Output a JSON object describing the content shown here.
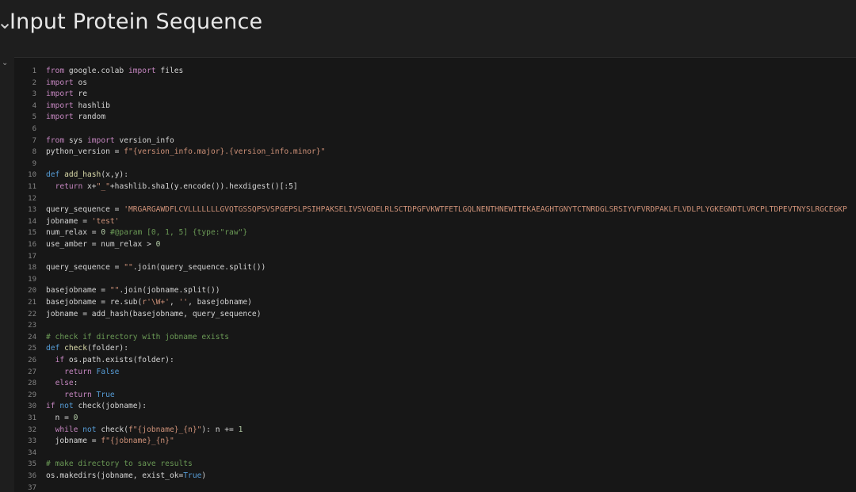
{
  "header": {
    "chevron": "⌄",
    "title": "Input Protein Sequence"
  },
  "cell": {
    "collapse_icon": "⌄"
  },
  "code": {
    "lines": [
      {
        "n": "1",
        "segs": [
          [
            "kw",
            "from "
          ],
          [
            "plain",
            "google.colab "
          ],
          [
            "kw",
            "import "
          ],
          [
            "plain",
            "files"
          ]
        ]
      },
      {
        "n": "2",
        "segs": [
          [
            "kw",
            "import "
          ],
          [
            "plain",
            "os"
          ]
        ]
      },
      {
        "n": "3",
        "segs": [
          [
            "kw",
            "import "
          ],
          [
            "plain",
            "re"
          ]
        ]
      },
      {
        "n": "4",
        "segs": [
          [
            "kw",
            "import "
          ],
          [
            "plain",
            "hashlib"
          ]
        ]
      },
      {
        "n": "5",
        "segs": [
          [
            "kw",
            "import "
          ],
          [
            "plain",
            "random"
          ]
        ]
      },
      {
        "n": "6",
        "segs": []
      },
      {
        "n": "7",
        "segs": [
          [
            "kw",
            "from "
          ],
          [
            "plain",
            "sys "
          ],
          [
            "kw",
            "import "
          ],
          [
            "plain",
            "version_info"
          ]
        ]
      },
      {
        "n": "8",
        "segs": [
          [
            "plain",
            "python_version = "
          ],
          [
            "str",
            "f\"{version_info.major}.{version_info.minor}\""
          ]
        ]
      },
      {
        "n": "9",
        "segs": []
      },
      {
        "n": "10",
        "segs": [
          [
            "kw2",
            "def "
          ],
          [
            "fn",
            "add_hash"
          ],
          [
            "plain",
            "(x,y):"
          ]
        ]
      },
      {
        "n": "11",
        "segs": [
          [
            "plain",
            "  "
          ],
          [
            "kw",
            "return "
          ],
          [
            "plain",
            "x+"
          ],
          [
            "str",
            "\"_\""
          ],
          [
            "plain",
            "+hashlib.sha1(y.encode()).hexdigest()[:5]"
          ]
        ]
      },
      {
        "n": "12",
        "segs": []
      },
      {
        "n": "13",
        "segs": [
          [
            "plain",
            "query_sequence = "
          ],
          [
            "str",
            "'MRGARGAWDFLCVLLLLLLLGVQTGSSQPSVSPGEPSLPSIHPAKSELIVSVGDELRLSCTDPGFVKWTFETLGQLNENTHNEWITEKAEAGHTGNYTCTNRDGLSRSIYVFVRDPAKLFLVDLPLYGKEGNDTLVRCPLTDPEVTNYSLRGCEGKP"
          ]
        ]
      },
      {
        "n": "14",
        "segs": [
          [
            "plain",
            "jobname = "
          ],
          [
            "str",
            "'test'"
          ]
        ]
      },
      {
        "n": "15",
        "segs": [
          [
            "plain",
            "num_relax = "
          ],
          [
            "num",
            "0 "
          ],
          [
            "com",
            "#@param [0, 1, 5] {type:\"raw\"}"
          ]
        ]
      },
      {
        "n": "16",
        "segs": [
          [
            "plain",
            "use_amber = num_relax > "
          ],
          [
            "num",
            "0"
          ]
        ]
      },
      {
        "n": "17",
        "segs": []
      },
      {
        "n": "18",
        "segs": [
          [
            "plain",
            "query_sequence = "
          ],
          [
            "str",
            "\"\""
          ],
          [
            "plain",
            ".join(query_sequence.split())"
          ]
        ]
      },
      {
        "n": "19",
        "segs": []
      },
      {
        "n": "20",
        "segs": [
          [
            "plain",
            "basejobname = "
          ],
          [
            "str",
            "\"\""
          ],
          [
            "plain",
            ".join(jobname.split())"
          ]
        ]
      },
      {
        "n": "21",
        "segs": [
          [
            "plain",
            "basejobname = re.sub("
          ],
          [
            "str",
            "r'\\W+'"
          ],
          [
            "plain",
            ", "
          ],
          [
            "str",
            "''"
          ],
          [
            "plain",
            ", basejobname)"
          ]
        ]
      },
      {
        "n": "22",
        "segs": [
          [
            "plain",
            "jobname = add_hash(basejobname, query_sequence)"
          ]
        ]
      },
      {
        "n": "23",
        "segs": []
      },
      {
        "n": "24",
        "segs": [
          [
            "com",
            "# check if directory with jobname exists"
          ]
        ]
      },
      {
        "n": "25",
        "segs": [
          [
            "kw2",
            "def "
          ],
          [
            "fn",
            "check"
          ],
          [
            "plain",
            "(folder):"
          ]
        ]
      },
      {
        "n": "26",
        "segs": [
          [
            "plain",
            "  "
          ],
          [
            "kw",
            "if "
          ],
          [
            "plain",
            "os.path.exists(folder):"
          ]
        ]
      },
      {
        "n": "27",
        "segs": [
          [
            "plain",
            "    "
          ],
          [
            "kw",
            "return "
          ],
          [
            "kw2",
            "False"
          ]
        ]
      },
      {
        "n": "28",
        "segs": [
          [
            "plain",
            "  "
          ],
          [
            "kw",
            "else"
          ],
          [
            "plain",
            ":"
          ]
        ]
      },
      {
        "n": "29",
        "segs": [
          [
            "plain",
            "    "
          ],
          [
            "kw",
            "return "
          ],
          [
            "kw2",
            "True"
          ]
        ]
      },
      {
        "n": "30",
        "segs": [
          [
            "kw",
            "if "
          ],
          [
            "kw2",
            "not "
          ],
          [
            "plain",
            "check(jobname):"
          ]
        ]
      },
      {
        "n": "31",
        "segs": [
          [
            "plain",
            "  n = "
          ],
          [
            "num",
            "0"
          ]
        ]
      },
      {
        "n": "32",
        "segs": [
          [
            "plain",
            "  "
          ],
          [
            "kw",
            "while "
          ],
          [
            "kw2",
            "not "
          ],
          [
            "plain",
            "check("
          ],
          [
            "str",
            "f\"{jobname}_{n}\""
          ],
          [
            "plain",
            "): n += "
          ],
          [
            "num",
            "1"
          ]
        ]
      },
      {
        "n": "33",
        "segs": [
          [
            "plain",
            "  jobname = "
          ],
          [
            "str",
            "f\"{jobname}_{n}\""
          ]
        ]
      },
      {
        "n": "34",
        "segs": []
      },
      {
        "n": "35",
        "segs": [
          [
            "com",
            "# make directory to save results"
          ]
        ]
      },
      {
        "n": "36",
        "segs": [
          [
            "plain",
            "os.makedirs(jobname, exist_ok="
          ],
          [
            "kw2",
            "True"
          ],
          [
            "plain",
            ")"
          ]
        ]
      },
      {
        "n": "37",
        "segs": []
      }
    ]
  }
}
